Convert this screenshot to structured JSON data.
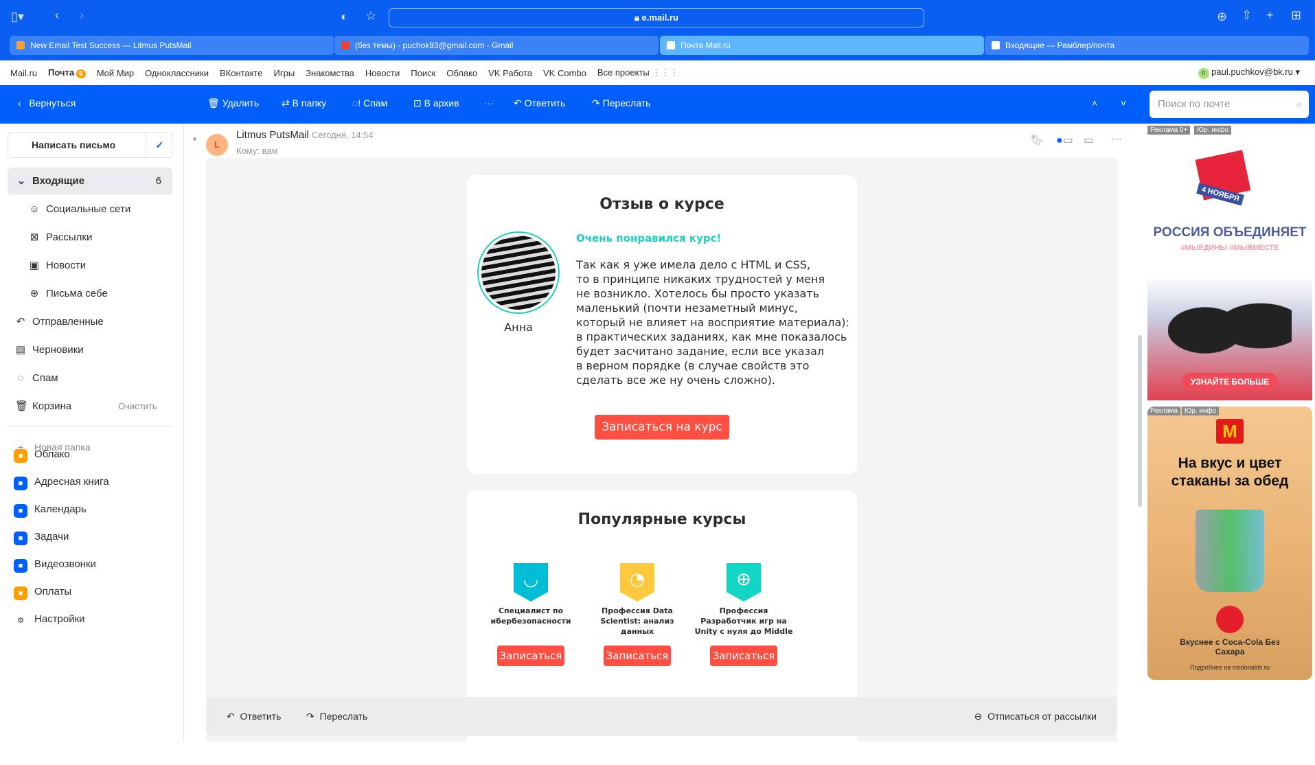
{
  "browser": {
    "url": "e.mail.ru",
    "tabs": [
      "New Email Test Success — Litmus PutsMail",
      "(без темы) - puchok93@gmail.com - Gmail",
      "Почта Mail.ru",
      "Входящие — Рамблер/почта"
    ]
  },
  "portal": {
    "items": [
      "Mail.ru",
      "Почта",
      "Мой Мир",
      "Одноклассники",
      "ВКонтакте",
      "Игры",
      "Знакомства",
      "Новости",
      "Поиск",
      "Облако",
      "VK Работа",
      "VK Combo",
      "Все проекты"
    ],
    "mail_count": "6",
    "user": "paul.puchkov@bk.ru",
    "user_initial": "п"
  },
  "toolbar": {
    "back": "Вернуться",
    "delete": "Удалить",
    "move": "В папку",
    "spam": "Спам",
    "archive": "В архив",
    "more": "···",
    "reply": "Ответить",
    "forward": "Переслать",
    "search_placeholder": "Поиск по почте"
  },
  "sidebar": {
    "compose": "Написать письмо",
    "inbox": "Входящие",
    "inbox_count": "6",
    "subfolders": [
      "Социальные сети",
      "Рассылки",
      "Новости",
      "Письма себе"
    ],
    "folders": [
      "Отправленные",
      "Черновики",
      "Спам",
      "Корзина"
    ],
    "clear": "Очистить",
    "new_folder": "Новая папка",
    "apps": [
      "Облако",
      "Адресная книга",
      "Календарь",
      "Задачи",
      "Видеозвонки",
      "Оплаты",
      "Настройки"
    ]
  },
  "message": {
    "sender": "Litmus PutsMail",
    "sender_initial": "L",
    "date": "Сегодня, 14:54",
    "to": "Кому: вам"
  },
  "review": {
    "title": "Отзыв о курсе",
    "name": "Анна",
    "headline": "Очень понравился курс!",
    "lines": [
      "Так как я уже имела дело с HTML и CSS,",
      "то в принципе никаких трудностей у меня",
      "не возникло. Хотелось бы просто указать",
      "маленький (почти незаметный минус,",
      "который не влияет на восприятие материала):",
      "в практических заданиях, как мне показалось",
      "будет засчитано задание, если все указал",
      "в верном порядке (в случае свойств это",
      "сделать все же ну очень сложно)."
    ],
    "button": "Записаться на курс"
  },
  "popular": {
    "title": "Популярные курсы",
    "courses": [
      {
        "name": "Специалист по ибербезопасности",
        "color": "#00bcd4",
        "button": "Записаться"
      },
      {
        "name": "Профессия Data Scientist: анализ данных",
        "color": "#ffc83d",
        "button": "Записаться"
      },
      {
        "name": "Профессия Разработчик игр на Unity с нуля до Middle",
        "color": "#12d5c3",
        "button": "Записаться"
      }
    ]
  },
  "bottom": {
    "reply": "Ответить",
    "forward": "Переслать",
    "unsubscribe": "Отписаться от рассылки"
  },
  "ads": {
    "ad1": {
      "label": "Реклама 0+",
      "info": "Юр. инфо",
      "badge": "4 НОЯБРЯ",
      "title": "РОССИЯ ОБЪЕДИНЯЕТ",
      "tags": "#МЫЕДИНЫ #МЫВМЕСТЕ",
      "cta": "УЗНАЙТЕ БОЛЬШЕ"
    },
    "ad2": {
      "label": "Реклама",
      "info": "Юр. инфо",
      "title": "На вкус и цвет стаканы за обед",
      "sub": "Вкуснее с Coca-Cola Без Сахара",
      "link": "Подробнее на mcdonalds.ru"
    }
  }
}
